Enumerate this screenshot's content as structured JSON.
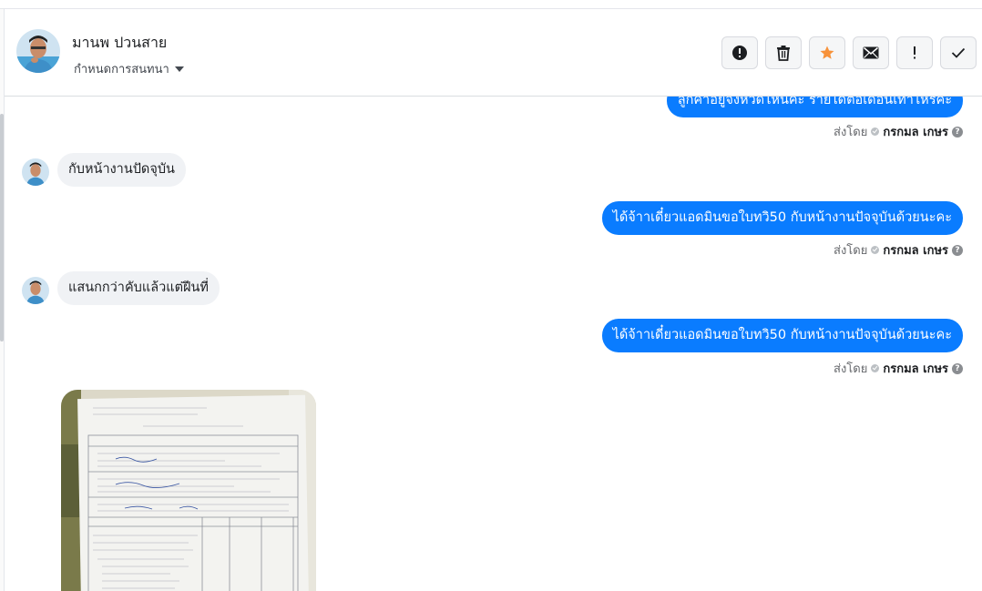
{
  "contact": {
    "name": "มานพ ปวนสาย",
    "assign_label": "กำหนดการสนทนา"
  },
  "toolbar": {
    "buttons": [
      {
        "icon": "alert-circle-icon",
        "name": "spam-button"
      },
      {
        "icon": "trash-icon",
        "name": "delete-button"
      },
      {
        "icon": "star-icon",
        "name": "star-button",
        "color": "#f7923a"
      },
      {
        "icon": "envelope-icon",
        "name": "mark-unread-button"
      },
      {
        "icon": "exclamation-icon",
        "name": "follow-up-button"
      },
      {
        "icon": "checkmark-icon",
        "name": "mark-done-button"
      }
    ]
  },
  "messages": [
    {
      "direction": "outgoing",
      "text": "ลูกค้าอยู่จังหวัดไหนคะ รายได้ต่อเดือนเท่าไหร่คะ",
      "sent_by_label": "ส่งโดย",
      "agent": "กรกมล เกษร"
    },
    {
      "direction": "incoming",
      "text": "กับหน้างานปัดจุบัน"
    },
    {
      "direction": "outgoing",
      "text": "ได้จ้าาเดี๋ยวแอดมินขอใบทวิ50 กับหน้างานปัจจุบันด้วยนะคะ",
      "sent_by_label": "ส่งโดย",
      "agent": "กรกมล เกษร"
    },
    {
      "direction": "incoming",
      "text": "แสนกกว่าคับแล้วแต่ฝีนที่"
    },
    {
      "direction": "outgoing",
      "text": "ได้จ้าาเดี๋ยวแอดมินขอใบทวิ50 กับหน้างานปัจจุบันด้วยนะคะ",
      "sent_by_label": "ส่งโดย",
      "agent": "กรกมล เกษร"
    },
    {
      "direction": "incoming",
      "type": "image",
      "description_icon": "document-photo"
    }
  ],
  "colors": {
    "outgoing_bubble": "#0a7cff",
    "incoming_bubble": "#f0f2f5",
    "star": "#f7923a"
  }
}
